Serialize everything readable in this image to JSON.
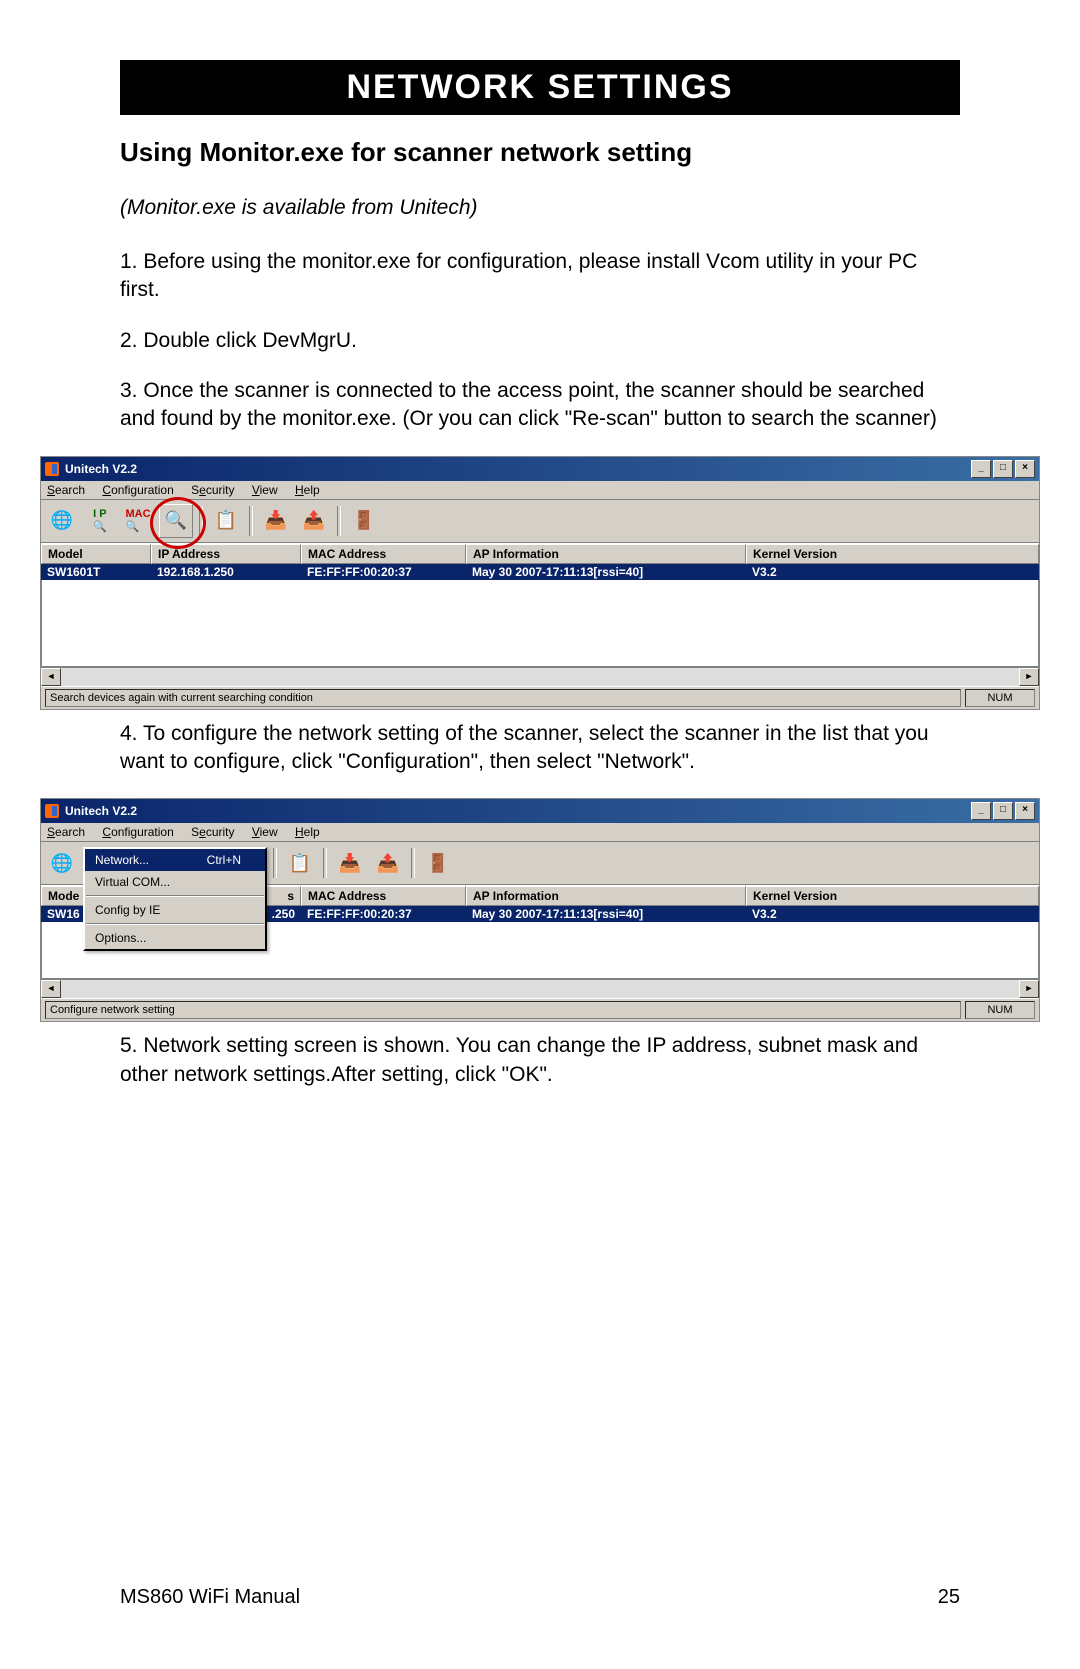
{
  "header": "NETWORK SETTINGS",
  "subtitle": "Using Monitor.exe for scanner network setting",
  "note": "(Monitor.exe is available from Unitech)",
  "step1": "1. Before using the monitor.exe for configuration, please install Vcom utility in your PC first.",
  "step2": "2. Double click DevMgrU.",
  "step3": "3. Once the scanner is connected to the access point, the scanner should be searched and found by the monitor.exe. (Or you can click \"Re-scan\" button to search the scanner)",
  "step4": "4. To configure the network setting of the scanner, select the scanner in the list that you want to configure, click \"Configuration\", then select \"Network\".",
  "step5": "5. Network setting screen is shown. You can change the IP address, subnet mask and other network settings.After setting, click \"OK\".",
  "app": {
    "title": "Unitech V2.2",
    "menus": {
      "search": "Search",
      "config": "Configuration",
      "security": "Security",
      "view": "View",
      "help": "Help"
    },
    "columns": {
      "model": "Model",
      "ip": "IP Address",
      "mac": "MAC Address",
      "ap": "AP Information",
      "kernel": "Kernel Version"
    },
    "row": {
      "model": "SW1601T",
      "ip": "192.168.1.250",
      "mac": "FE:FF:FF:00:20:37",
      "ap": "May 30 2007-17:11:13[rssi=40]",
      "kernel": "V3.2"
    },
    "row2": {
      "model": "SW16",
      "ip": ".250",
      "mac": "FE:FF:FF:00:20:37",
      "ap": "May 30 2007-17:11:13[rssi=40]",
      "kernel": "V3.2"
    },
    "status1": "Search devices again with current searching condition",
    "status2": "Configure network setting",
    "num": "NUM",
    "dropdown": {
      "network": "Network...",
      "network_shortcut": "Ctrl+N",
      "vcom": "Virtual COM...",
      "configie": "Config by IE",
      "options": "Options..."
    }
  },
  "footer": {
    "left": "MS860 WiFi Manual",
    "right": "25"
  }
}
